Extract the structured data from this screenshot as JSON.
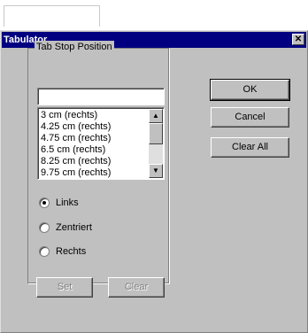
{
  "dialog": {
    "title": "Tabulator",
    "close_glyph": "✕"
  },
  "group": {
    "label": "Tab Stop Position",
    "position_value": "",
    "list_items": [
      "3 cm (rechts)",
      "4.25 cm (rechts)",
      "4.75 cm (rechts)",
      "6.5 cm (rechts)",
      "8.25 cm (rechts)",
      "9.75 cm (rechts)"
    ]
  },
  "alignment": {
    "selected": "links",
    "options": [
      "Links",
      "Zentriert",
      "Rechts"
    ]
  },
  "buttons": {
    "ok": "OK",
    "cancel": "Cancel",
    "clear_all": "Clear All",
    "set": "Set",
    "clear": "Clear"
  }
}
